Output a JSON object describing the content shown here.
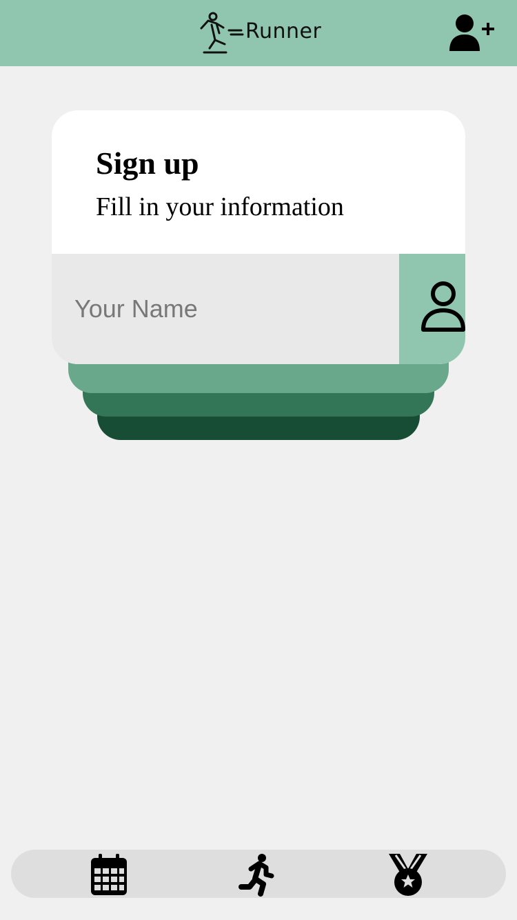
{
  "header": {
    "app_name": "Runner",
    "logo_icon": "runner-logo-icon",
    "add_user_icon": "add-user-icon"
  },
  "signup": {
    "title": "Sign up",
    "subtitle": "Fill in your information",
    "name_placeholder": "Your Name",
    "name_value": "",
    "field_icon": "user-outline-icon"
  },
  "bottom_nav": {
    "items": [
      {
        "icon": "calendar-icon"
      },
      {
        "icon": "running-person-icon"
      },
      {
        "icon": "medal-icon"
      }
    ]
  },
  "colors": {
    "header_bg": "#90c6af",
    "page_bg": "#f1f0f0",
    "layer_light": "#6aa88c",
    "layer_mid": "#337657",
    "layer_dark": "#184d35",
    "input_bg": "#e9e9e9",
    "nav_bg": "#dedede"
  }
}
